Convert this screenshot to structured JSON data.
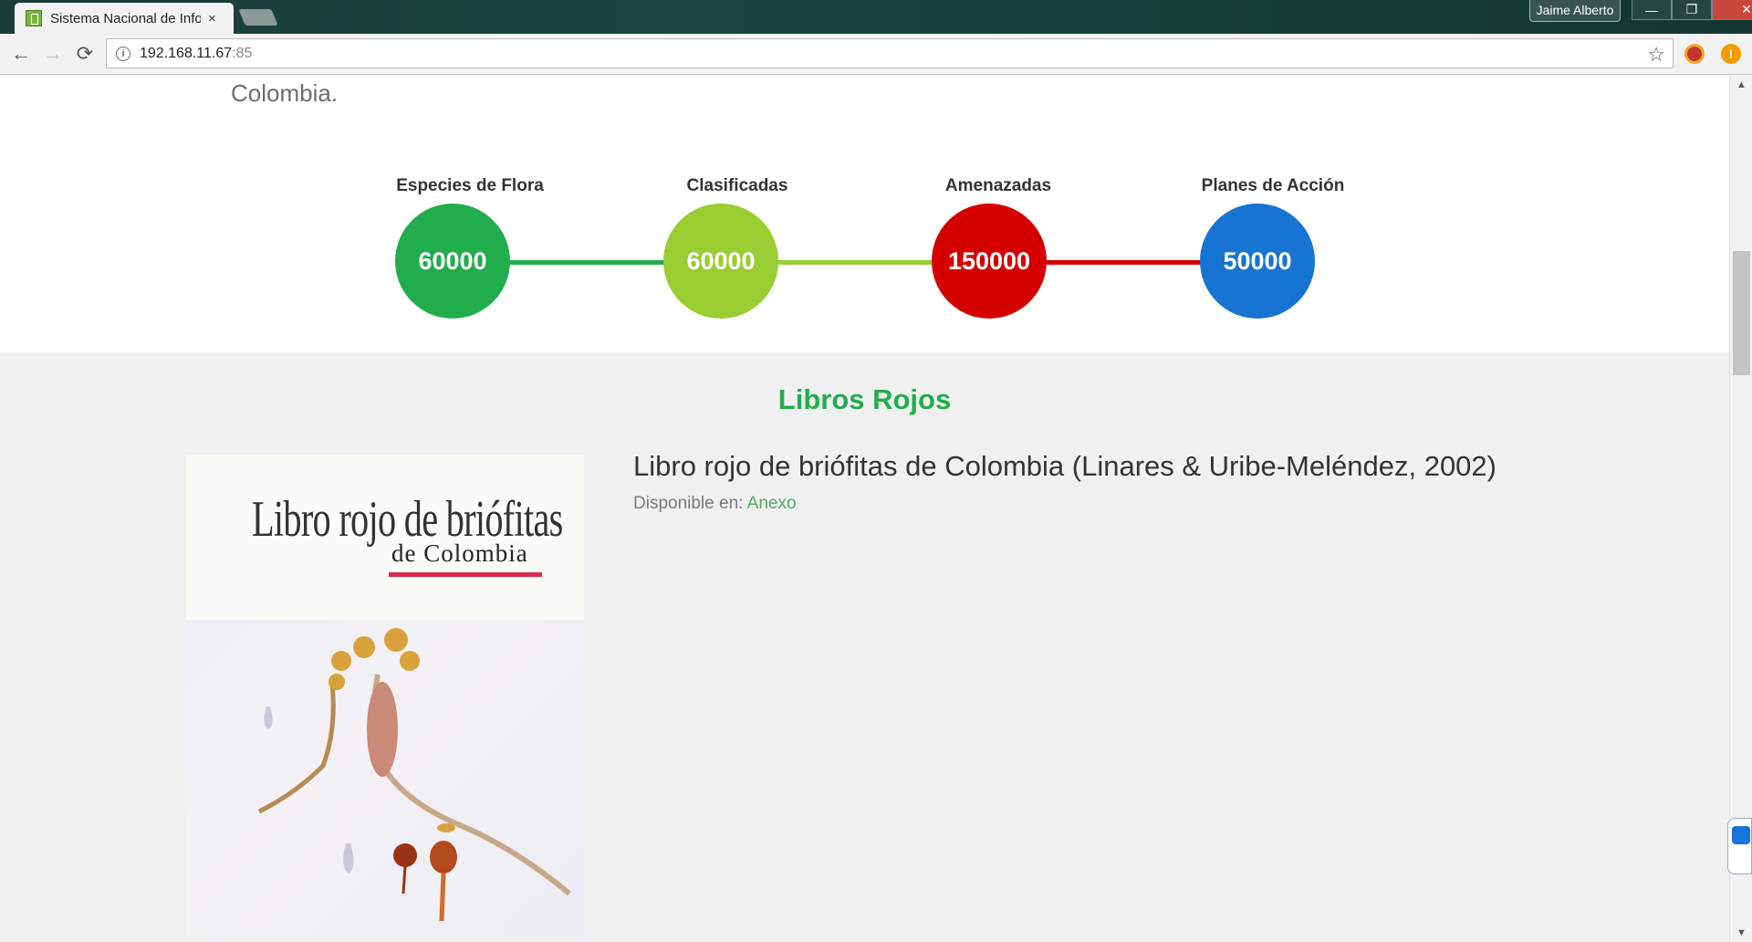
{
  "browser": {
    "tab_title": "Sistema Nacional de Info",
    "tab_close": "×",
    "profile_name": "Jaime Alberto",
    "win_min": "—",
    "win_max": "❐",
    "win_close": "✕",
    "back": "←",
    "forward": "→",
    "reload": "⟳",
    "url_host": "192.168.11.67",
    "url_port": ":85",
    "star": "☆",
    "alert_badge": "!"
  },
  "intro": {
    "tail_text": "Colombia."
  },
  "stats": [
    {
      "label": "Especies de Flora",
      "value": "60000",
      "color": "#22ad4c"
    },
    {
      "label": "Clasificadas",
      "value": "60000",
      "color": "#9acd32"
    },
    {
      "label": "Amenazadas",
      "value": "150000",
      "color": "#d40000"
    },
    {
      "label": "Planes de Acción",
      "value": "50000",
      "color": "#1874d2"
    }
  ],
  "stats_connectors": [
    "#22ad4c",
    "#9acd32",
    "#d40000"
  ],
  "libros": {
    "section_title": "Libros Rojos",
    "cover_title_line1": "Libro rojo de briófitas",
    "cover_title_line2": "de Colombia",
    "book_title": "Libro rojo de briófitas de Colombia (Linares & Uribe-Meléndez, 2002)",
    "available_label": "Disponible en: ",
    "available_link": "Anexo"
  },
  "scrollbar": {
    "up": "▲",
    "down": "▼",
    "thumb_position_fraction": 0.2
  }
}
